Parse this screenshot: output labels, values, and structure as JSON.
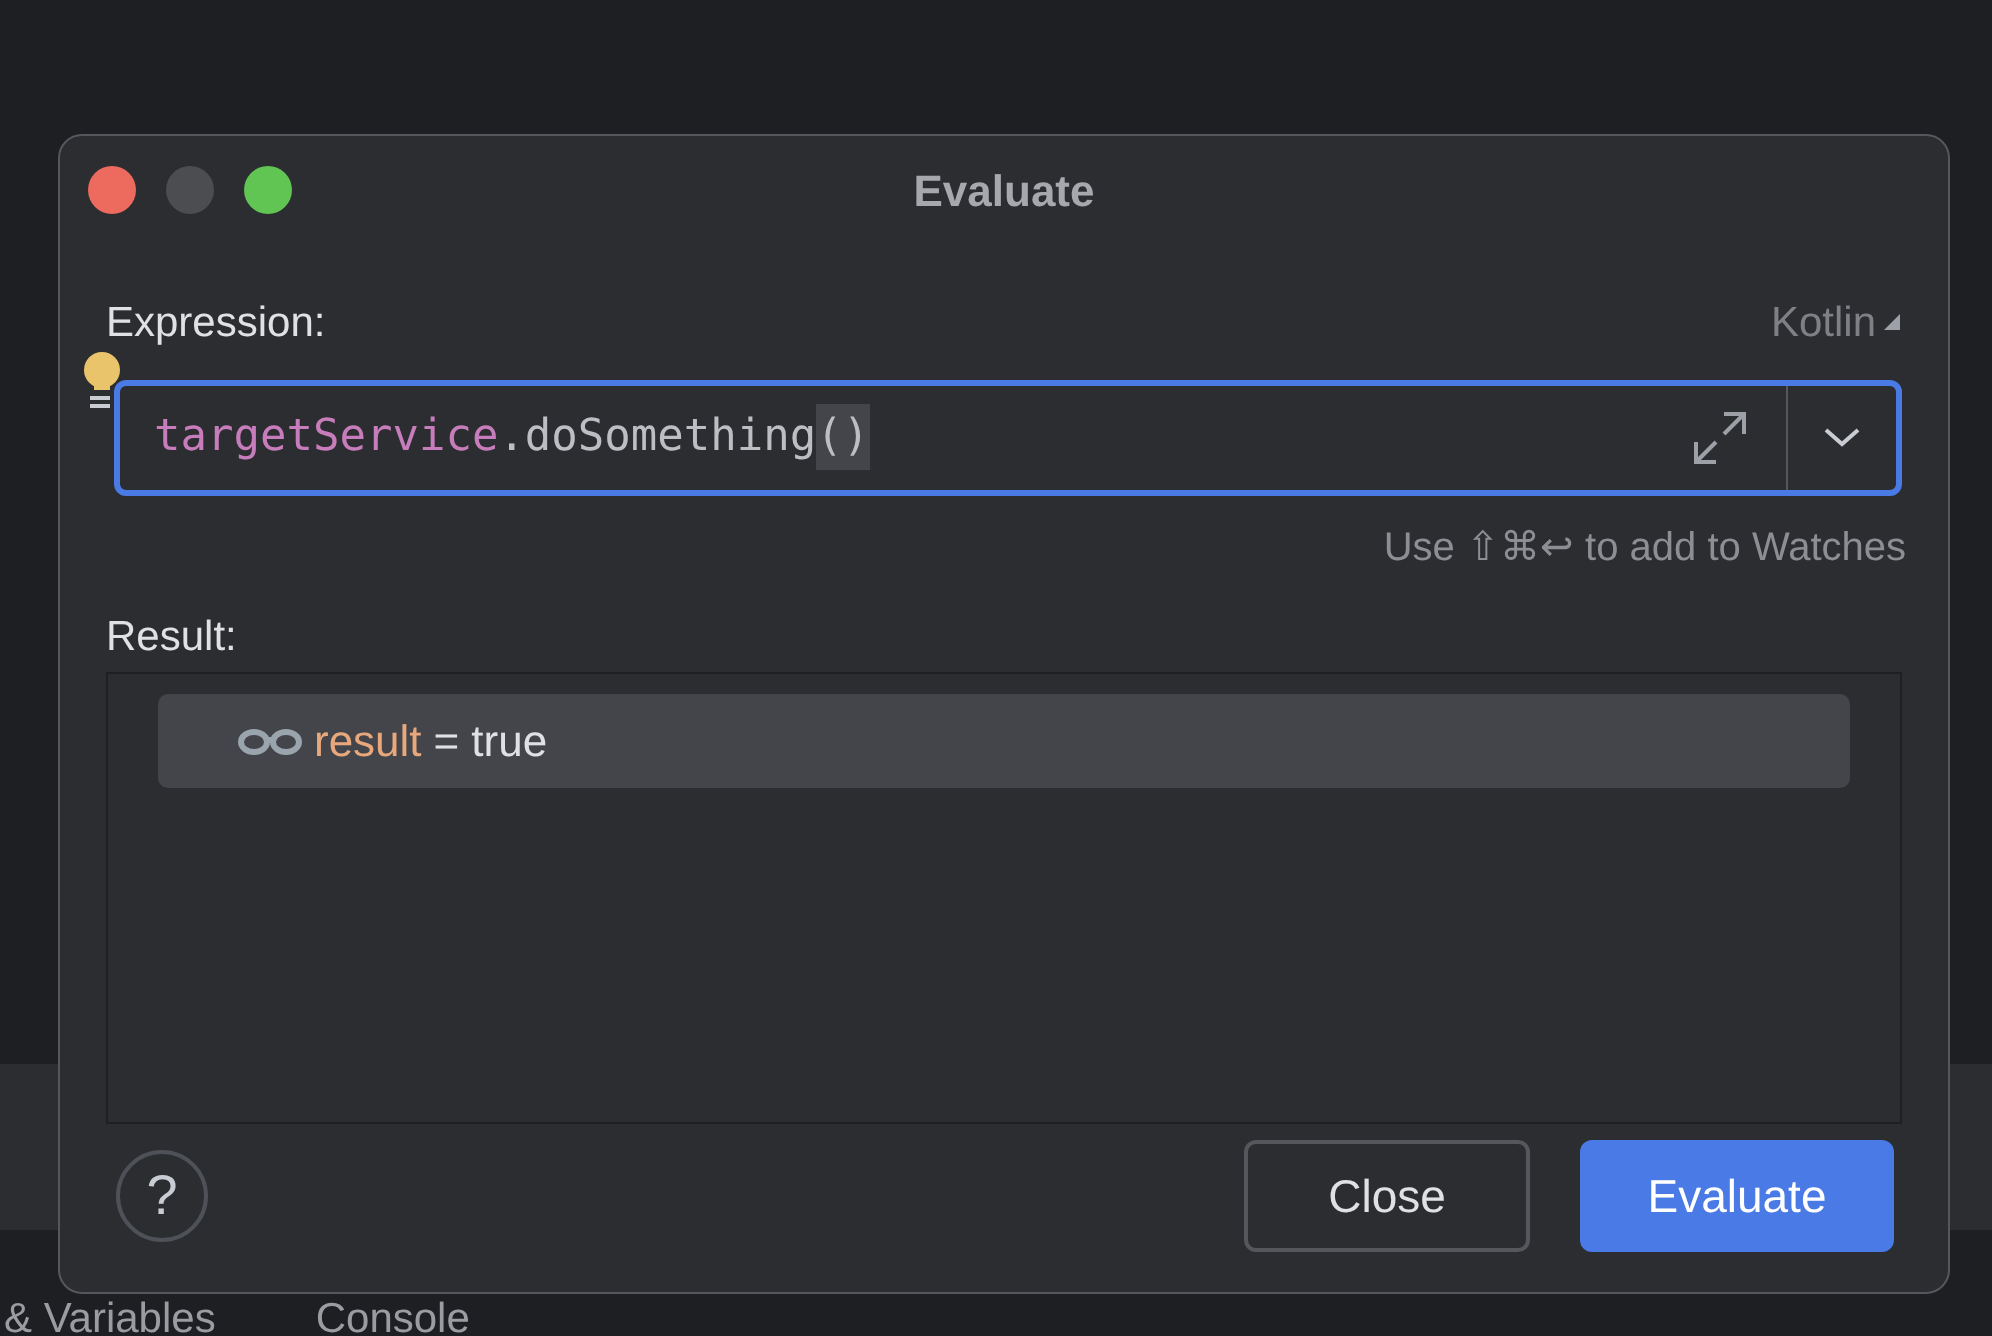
{
  "background_tabs": [
    {
      "label": "& Variables"
    },
    {
      "label": "Console"
    }
  ],
  "dialog": {
    "title": "Evaluate",
    "traffic_lights": [
      {
        "kind": "close",
        "disabled": false
      },
      {
        "kind": "minimize",
        "disabled": true
      },
      {
        "kind": "zoom",
        "disabled": false
      }
    ],
    "expression": {
      "label": "Expression:",
      "language": "Kotlin",
      "tokens": [
        {
          "text": "targetService",
          "kind": "identifier"
        },
        {
          "text": ".doSomething",
          "kind": "call"
        },
        {
          "text": "()",
          "kind": "brace_match"
        }
      ],
      "hint": "Use ⇧⌘↩ to add to Watches"
    },
    "result": {
      "label": "Result:",
      "rows": [
        {
          "name": "result",
          "separator": "=",
          "value": "true",
          "selected": true
        }
      ]
    },
    "help": "?",
    "buttons": [
      {
        "label": "Close",
        "kind": "secondary"
      },
      {
        "label": "Evaluate",
        "kind": "primary"
      }
    ]
  }
}
